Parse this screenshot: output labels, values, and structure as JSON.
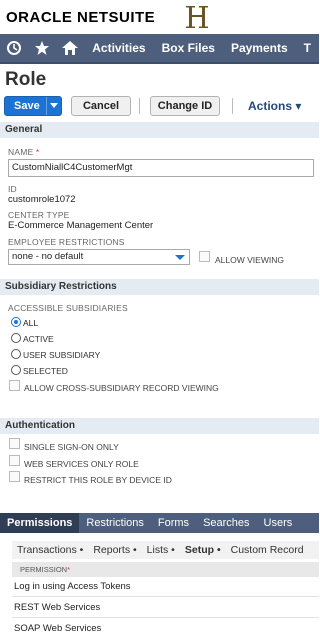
{
  "header": {
    "brand_oracle": "ORACLE",
    "brand_netsuite": "NETSUITE"
  },
  "nav": {
    "items": [
      "Activities",
      "Box Files",
      "Payments",
      "T"
    ],
    "icons": [
      "recent-clock-icon",
      "star-icon",
      "home-icon"
    ]
  },
  "page": {
    "title": "Role"
  },
  "toolbar": {
    "save_label": "Save",
    "cancel_label": "Cancel",
    "change_id_label": "Change ID",
    "actions_label": "Actions ▾"
  },
  "general": {
    "header": "General",
    "name_label": "NAME",
    "name_required": "*",
    "name_value": "CustomNiallC4CustomerMgt",
    "id_label": "ID",
    "id_value": "customrole1072",
    "center_type_label": "CENTER TYPE",
    "center_type_value": "E-Commerce Management Center",
    "employee_restrictions_label": "EMPLOYEE RESTRICTIONS",
    "employee_restrictions_value": "none - no default",
    "allow_viewing_label": "ALLOW VIEWING"
  },
  "subsidiary": {
    "header": "Subsidiary Restrictions",
    "accessible_label": "ACCESSIBLE SUBSIDIARIES",
    "options": [
      "ALL",
      "ACTIVE",
      "USER SUBSIDIARY",
      "SELECTED"
    ],
    "selected": "ALL",
    "cross_label": "ALLOW CROSS-SUBSIDIARY RECORD VIEWING"
  },
  "authentication": {
    "header": "Authentication",
    "options": [
      "SINGLE SIGN-ON ONLY",
      "WEB SERVICES ONLY ROLE",
      "RESTRICT THIS ROLE BY DEVICE ID"
    ]
  },
  "tabs": {
    "items": [
      "Permissions",
      "Restrictions",
      "Forms",
      "Searches",
      "Users"
    ],
    "active": "Permissions"
  },
  "subtabs": {
    "items": [
      "Transactions •",
      "Reports •",
      "Lists •",
      "Setup •",
      "Custom Record"
    ],
    "active": "Setup •"
  },
  "permissions_table": {
    "header": "PERMISSION",
    "header_required": "*",
    "rows": [
      "Log in using Access Tokens",
      "REST Web Services",
      "SOAP Web Services"
    ]
  },
  "colors": {
    "nav_bg": "#4d5f7c",
    "primary": "#1b73d3",
    "section_bg": "#e5ebf2"
  }
}
